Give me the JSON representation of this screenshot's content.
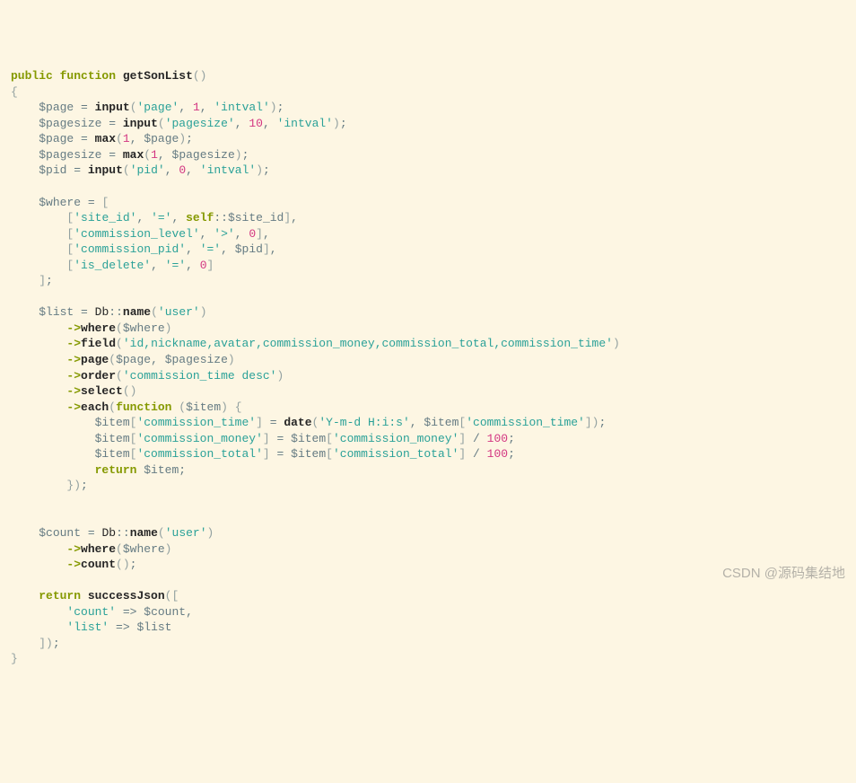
{
  "code": {
    "visibility": "public",
    "kw_function": "function",
    "kw_self": "self",
    "kw_return": "return",
    "fn_name": "getSonList",
    "fn_input": "input",
    "fn_max": "max",
    "fn_db": "Db",
    "fn_name_meth": "name",
    "fn_where_meth": "where",
    "fn_field_meth": "field",
    "fn_page_meth": "page",
    "fn_order_meth": "order",
    "fn_select_meth": "select",
    "fn_each_meth": "each",
    "fn_count_meth": "count",
    "fn_date": "date",
    "fn_successJson": "successJson",
    "var_page": "$page",
    "var_pagesize": "$pagesize",
    "var_pid": "$pid",
    "var_where": "$where",
    "var_list": "$list",
    "var_item": "$item",
    "var_count": "$count",
    "static_site": "$site_id",
    "str_page": "'page'",
    "str_pagesize": "'pagesize'",
    "str_intval": "'intval'",
    "str_pid": "'pid'",
    "str_site_id": "'site_id'",
    "str_eq": "'='",
    "str_gt": "'>'",
    "str_commission_level": "'commission_level'",
    "str_commission_pid": "'commission_pid'",
    "str_is_delete": "'is_delete'",
    "str_user": "'user'",
    "str_fields": "'id,nickname,avatar,commission_money,commission_total,commission_time'",
    "str_order": "'commission_time desc'",
    "str_ctime": "'commission_time'",
    "str_cmoney": "'commission_money'",
    "str_ctotal": "'commission_total'",
    "str_datefmt": "'Y-m-d H:i:s'",
    "str_count": "'count'",
    "str_list": "'list'",
    "num_1": "1",
    "num_10": "10",
    "num_0": "0",
    "num_100": "100"
  },
  "watermark": "CSDN @源码集结地"
}
